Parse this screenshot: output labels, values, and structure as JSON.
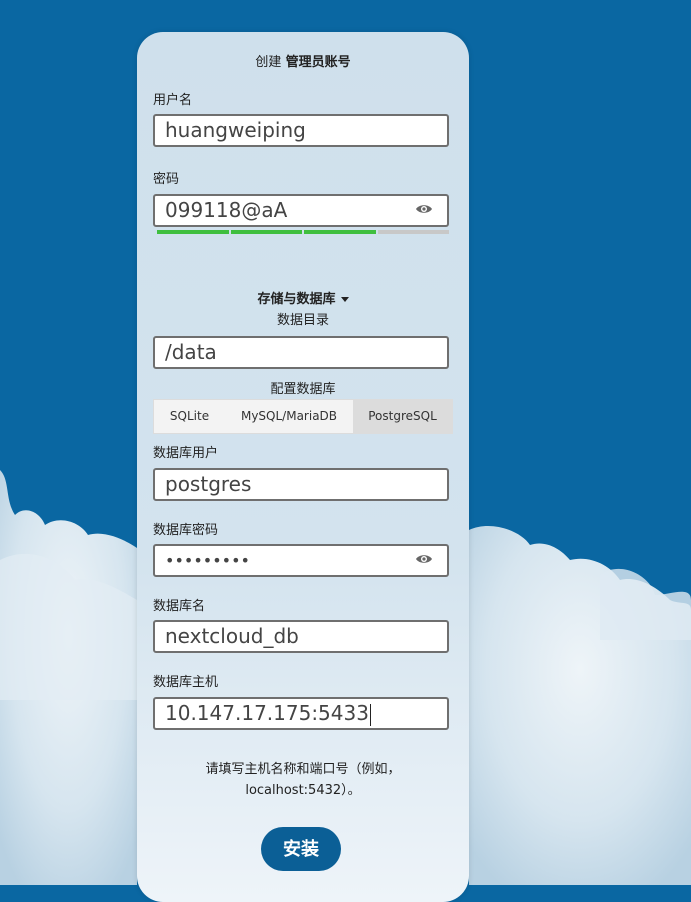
{
  "form": {
    "title_prefix": "创建",
    "title_bold": "管理员账号",
    "username_label": "用户名",
    "username_value": "huangweiping",
    "password_label": "密码",
    "password_value": "099118@aA",
    "password_strength": 0.75,
    "storage_toggle": "存储与数据库",
    "data_dir_label": "数据目录",
    "data_dir_value": "/data",
    "db_config_label": "配置数据库",
    "db_tabs": [
      "SQLite",
      "MySQL/MariaDB",
      "PostgreSQL"
    ],
    "db_tab_selected": "PostgreSQL",
    "db_user_label": "数据库用户",
    "db_user_value": "postgres",
    "db_password_label": "数据库密码",
    "db_password_value": "•••••••••",
    "db_name_label": "数据库名",
    "db_name_value": "nextcloud_db",
    "db_host_label": "数据库主机",
    "db_host_value": "10.147.17.175:5433",
    "hint_line1": "请填写主机名称和端口号（例如，",
    "hint_line2": "localhost:5432）。",
    "install_label": "安装"
  },
  "colors": {
    "background": "#0a67a2",
    "button": "#0b5f96",
    "strength_good": "#3fbf3f",
    "strength_empty": "#c8c8c8"
  },
  "icons": {
    "password_eye": "eye-icon",
    "db_password_eye": "eye-icon",
    "storage_caret": "caret-down-icon"
  }
}
